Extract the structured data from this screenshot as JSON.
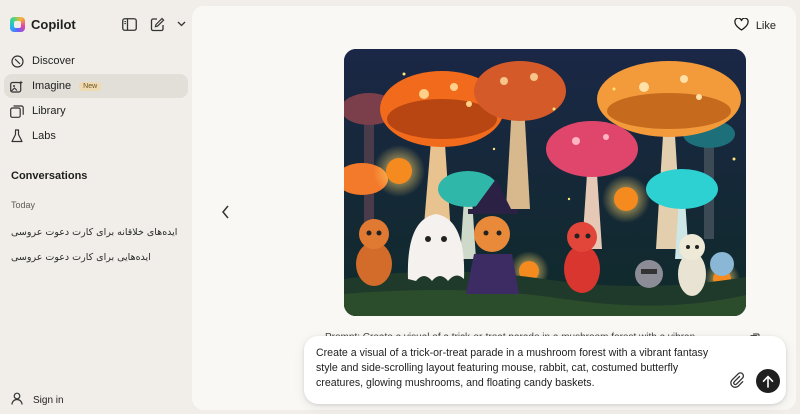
{
  "app": {
    "name": "Copilot"
  },
  "sidebar": {
    "nav": [
      {
        "label": "Discover",
        "icon": "compass-icon"
      },
      {
        "label": "Imagine",
        "icon": "image-sparkle-icon",
        "badge": "New",
        "active": true
      },
      {
        "label": "Library",
        "icon": "library-icon"
      },
      {
        "label": "Labs",
        "icon": "flask-icon"
      }
    ],
    "conversations_title": "Conversations",
    "group_today": "Today",
    "conversations": [
      "ایده‌های خلاقانه برای کارت دعوت عروسی",
      "ایده‌هایی برای کارت دعوت عروسی"
    ],
    "sign_in": "Sign in"
  },
  "main": {
    "like_label": "Like",
    "prompt_peek": "Prompt: Create a visual of a trick-or-treat parade in a mushroom forest with a vibran",
    "composer_text": "Create a visual of a trick-or-treat parade in a mushroom forest with a vibrant fantasy style and side-scrolling layout featuring mouse, rabbit, cat, costumed butterfly creatures, glowing mushrooms, and floating candy baskets."
  },
  "colors": {
    "sidebar_bg": "#f1eeea",
    "main_bg": "#faf8f5",
    "active_item": "#e2ded8",
    "badge_bg": "#efd9b2",
    "send_button": "#1f1f1f"
  }
}
